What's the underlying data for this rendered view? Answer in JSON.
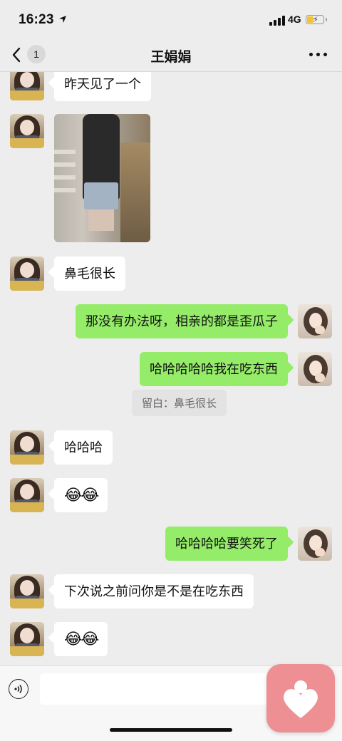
{
  "status_bar": {
    "time": "16:23",
    "network": "4G"
  },
  "nav": {
    "back_badge": "1",
    "title": "王娟娟"
  },
  "messages": [
    {
      "side": "left",
      "type": "text",
      "text": "昨天见了一个"
    },
    {
      "side": "left",
      "type": "image",
      "text": ""
    },
    {
      "side": "left",
      "type": "text",
      "text": "鼻毛很长"
    },
    {
      "side": "right",
      "type": "text",
      "text": "那没有办法呀，相亲的都是歪瓜子"
    },
    {
      "side": "right",
      "type": "text",
      "text": "哈哈哈哈哈我在吃东西",
      "quote": "留白：鼻毛很长"
    },
    {
      "side": "left",
      "type": "text",
      "text": "哈哈哈"
    },
    {
      "side": "left",
      "type": "text",
      "text": "😂😂"
    },
    {
      "side": "right",
      "type": "text",
      "text": "哈哈哈哈要笑死了"
    },
    {
      "side": "left",
      "type": "text",
      "text": "下次说之前问你是不是在吃东西"
    },
    {
      "side": "left",
      "type": "text",
      "text": "😂😂"
    }
  ],
  "input": {
    "value": "",
    "placeholder": ""
  },
  "icons": {
    "location": "location-arrow-icon",
    "back": "chevron-left-icon",
    "more": "more-dots-icon",
    "voice": "voice-icon",
    "floating_app": "heart-app-icon"
  },
  "colors": {
    "outgoing_bubble": "#95ec69",
    "incoming_bubble": "#ffffff",
    "background": "#ededed",
    "floating_app": "#ee8f93"
  }
}
